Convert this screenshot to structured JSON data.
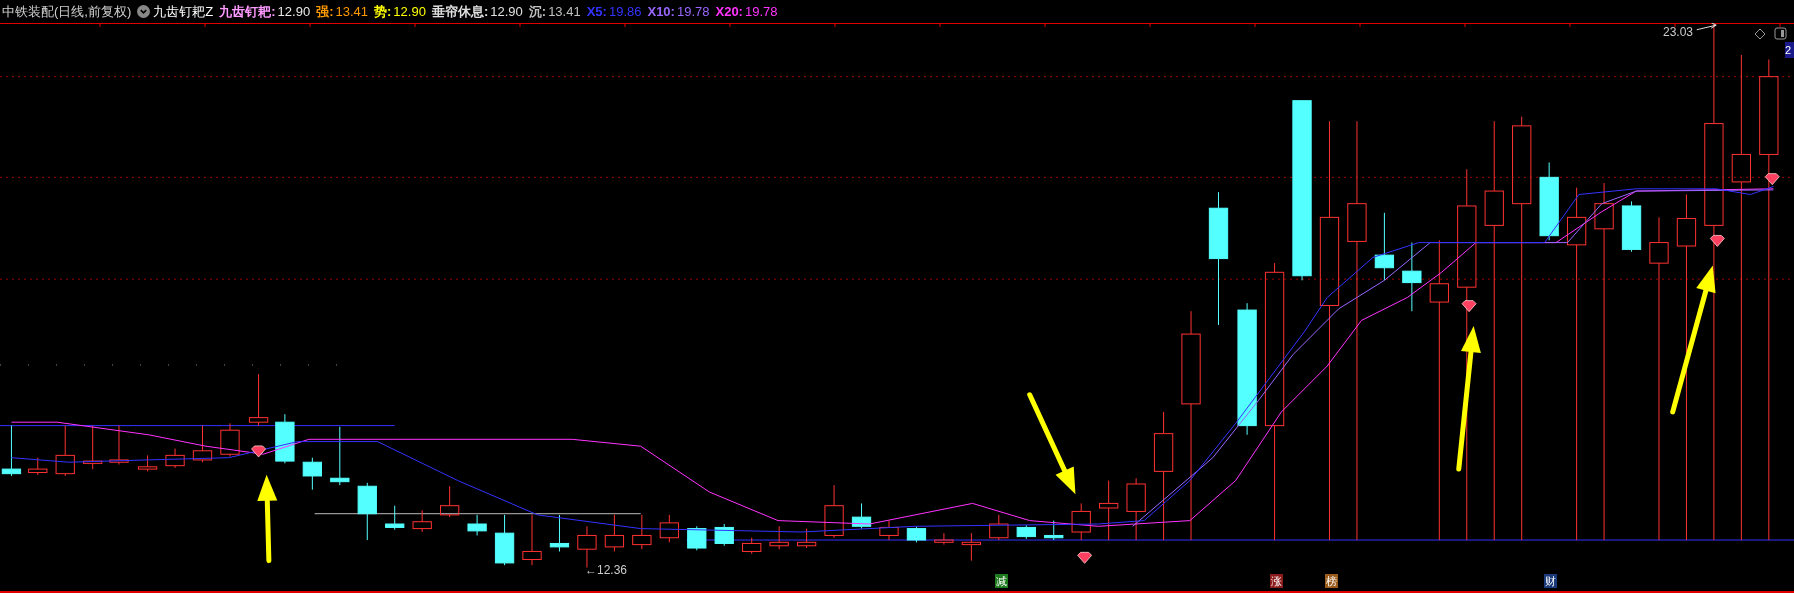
{
  "header": {
    "title": "中铁装配(日线,前复权)",
    "indicator": "九齿钉耙Z",
    "legend": [
      {
        "label": "九齿钉耙:",
        "value": "12.90",
        "color": "#ff99ff"
      },
      {
        "label": "强:",
        "value": "13.41",
        "color": "#ff9900"
      },
      {
        "label": "势:",
        "value": "12.90",
        "color": "#ffff00"
      },
      {
        "label": "垂帘休息:",
        "value": "12.90",
        "color": "#e0e0e0"
      },
      {
        "label": "沉:",
        "value": "13.41",
        "color": "#c0c0c0"
      },
      {
        "label": "X5:",
        "value": "19.86",
        "color": "#3333ff"
      },
      {
        "label": "X10:",
        "value": "19.78",
        "color": "#9966ff"
      },
      {
        "label": "X20:",
        "value": "19.78",
        "color": "#ff33ff"
      }
    ]
  },
  "chart": {
    "high_label": "23.03",
    "low_label": "←12.36",
    "side_badge": "2",
    "signals": [
      {
        "label": "减",
        "color": "#1e7a1e"
      },
      {
        "label": "涨",
        "color": "#8b1a1a"
      },
      {
        "label": "榜",
        "color": "#9a5a1a"
      },
      {
        "label": "财",
        "color": "#1a3a7a"
      }
    ]
  }
}
